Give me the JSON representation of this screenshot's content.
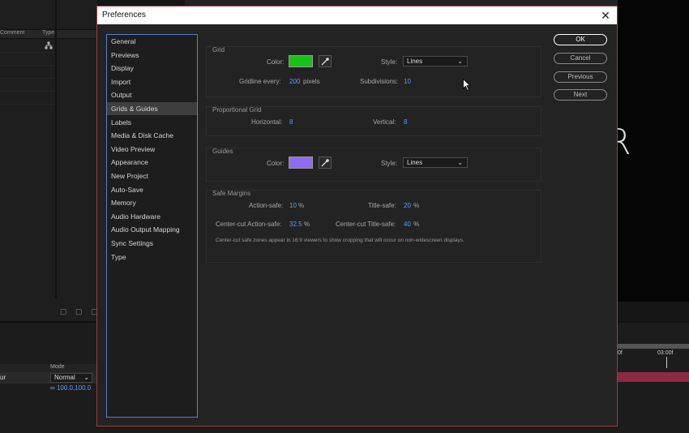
{
  "background": {
    "comment_col": "Comment",
    "type_col": "Type",
    "mode_col": "Mode",
    "mode_value": "Normal",
    "layer_fragment": "ur",
    "scale_value": "100.0,100.0",
    "ruler_start": "0f",
    "ruler_3s": "03:00f",
    "viewer_letter": "R"
  },
  "dialog": {
    "title": "Preferences",
    "close_glyph": "✕",
    "categories": [
      "General",
      "Previews",
      "Display",
      "Import",
      "Output",
      "Grids & Guides",
      "Labels",
      "Media & Disk Cache",
      "Video Preview",
      "Appearance",
      "New Project",
      "Auto-Save",
      "Memory",
      "Audio Hardware",
      "Audio Output Mapping",
      "Sync Settings",
      "Type"
    ],
    "selected_category": "Grids & Guides",
    "buttons": {
      "ok": "OK",
      "cancel": "Cancel",
      "previous": "Previous",
      "next": "Next"
    }
  },
  "grid": {
    "title": "Grid",
    "color_label": "Color:",
    "color": "#18c218",
    "style_label": "Style:",
    "style_value": "Lines",
    "gridline_label": "Gridline every:",
    "gridline_value": "200",
    "gridline_unit": "pixels",
    "subdiv_label": "Subdivisions:",
    "subdiv_value": "10"
  },
  "proportional": {
    "title": "Proportional Grid",
    "horizontal_label": "Horizontal:",
    "horizontal_value": "8",
    "vertical_label": "Vertical:",
    "vertical_value": "8"
  },
  "guides": {
    "title": "Guides",
    "color_label": "Color:",
    "color": "#8f6bf0",
    "style_label": "Style:",
    "style_value": "Lines"
  },
  "safe": {
    "title": "Safe Margins",
    "action_label": "Action-safe:",
    "action_value": "10",
    "title_label": "Title-safe:",
    "title_value": "20",
    "cc_action_label": "Center-cut Action-safe:",
    "cc_action_value": "32.5",
    "cc_title_label": "Center-cut Title-safe:",
    "cc_title_value": "40",
    "percent": "%",
    "note": "Center-cut safe zones appear in 16:9 viewers to show cropping that will occur on non-widescreen displays."
  }
}
